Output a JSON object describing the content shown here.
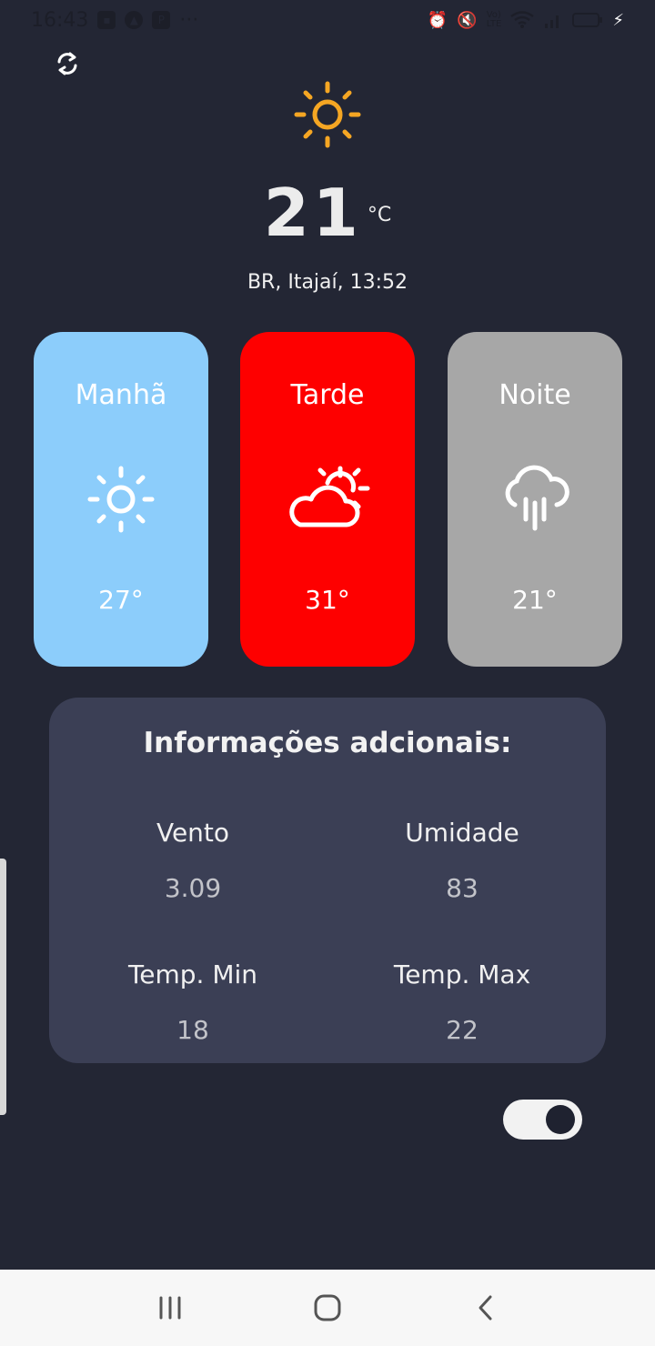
{
  "status_bar": {
    "time": "16:43",
    "icons": [
      "image-icon",
      "app-icon",
      "parking-icon",
      "more-icon",
      "alarm-icon",
      "mute-icon",
      "volte-icon",
      "wifi-icon",
      "signal-icon",
      "battery-icon",
      "charging-icon"
    ]
  },
  "weather": {
    "current_temp": "21",
    "unit": "°C",
    "location": "BR,  Itajaí, 13:52",
    "main_icon": "sun-icon",
    "icon_color": "#f5a623"
  },
  "periods": [
    {
      "label": "Manhã",
      "temp": "27°",
      "icon": "sun-icon",
      "color": "#8ccdfb"
    },
    {
      "label": "Tarde",
      "temp": "31°",
      "icon": "partly-cloudy-icon",
      "color": "#fe0000"
    },
    {
      "label": "Noite",
      "temp": "21°",
      "icon": "rain-icon",
      "color": "#a7a7a7"
    }
  ],
  "additional_info": {
    "title": "Informações adcionais:",
    "wind_label": "Vento",
    "wind_value": "3.09",
    "humidity_label": "Umidade",
    "humidity_value": "83",
    "temp_min_label": "Temp. Min",
    "temp_min_value": "18",
    "temp_max_label": "Temp. Max",
    "temp_max_value": "22"
  },
  "theme_toggle": {
    "on": true
  },
  "nav": {
    "recent": "recent-apps-icon",
    "home": "home-icon",
    "back": "back-icon"
  }
}
